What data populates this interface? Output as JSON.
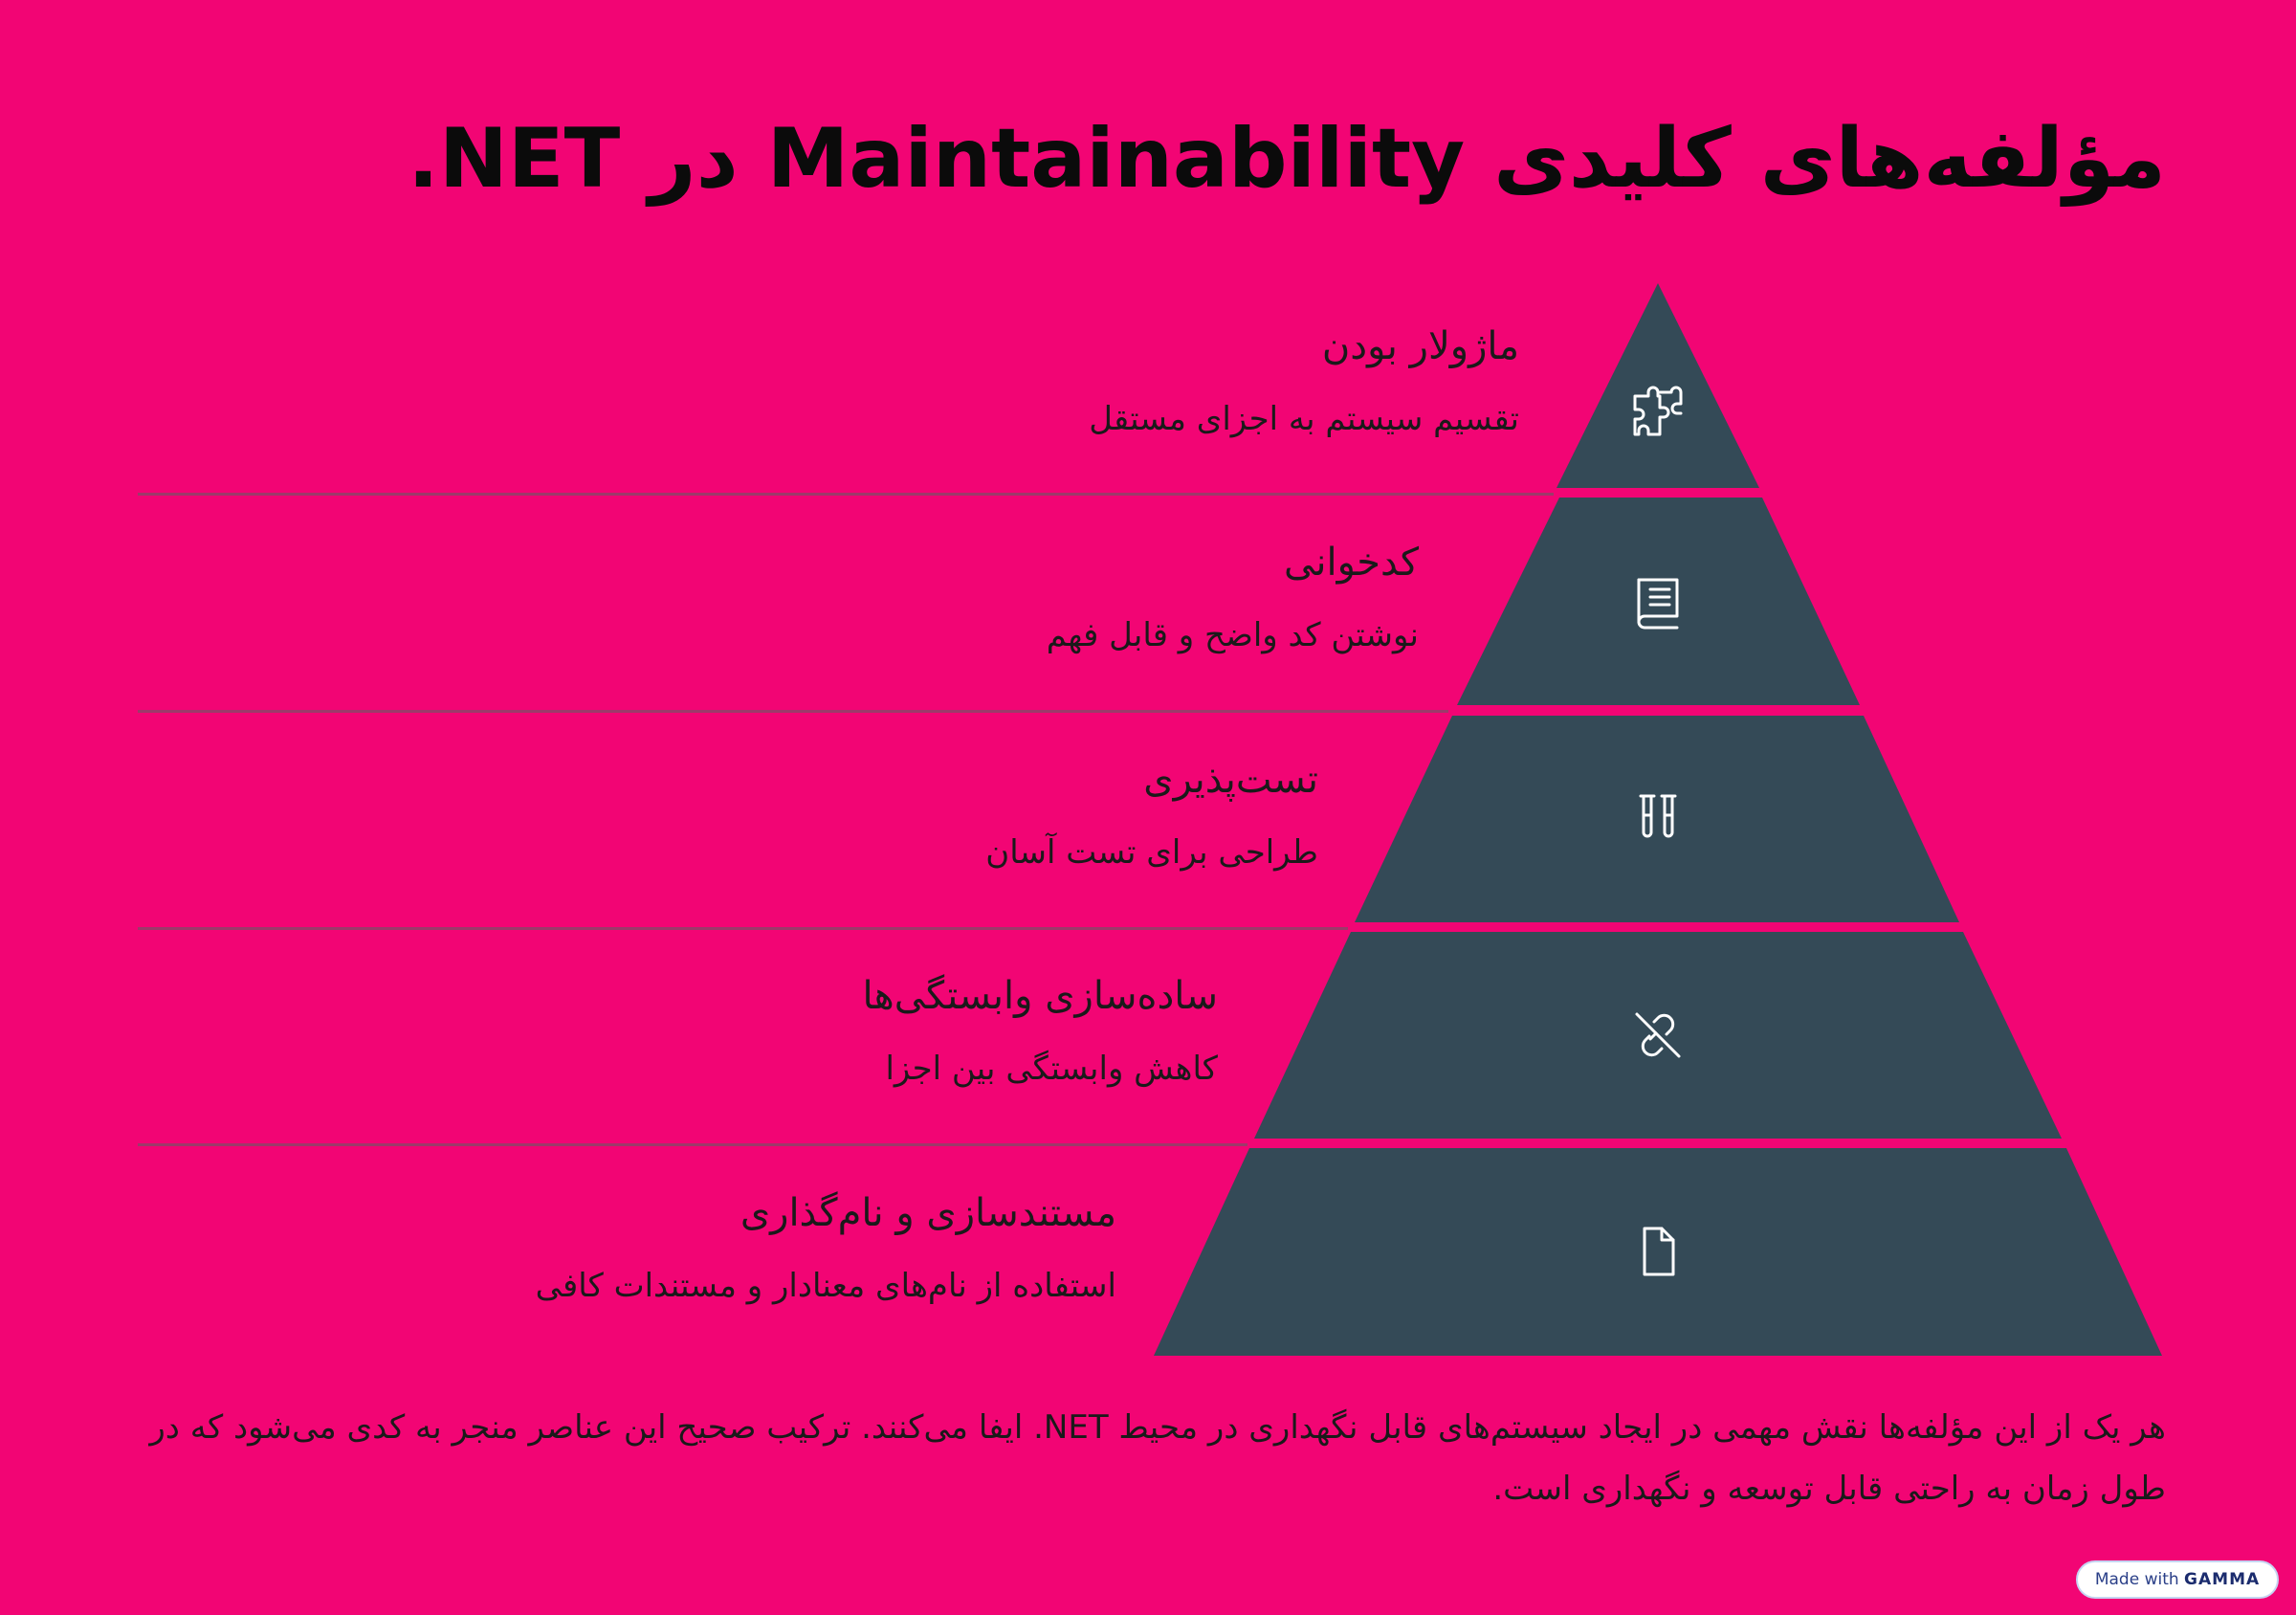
{
  "slide": {
    "title": "مؤلفه‌های کلیدی Maintainability در NET.",
    "layers": [
      {
        "title": "ماژولار بودن",
        "description": "تقسیم سیستم به اجزای مستقل",
        "icon": "puzzle-icon"
      },
      {
        "title": "کدخوانی",
        "description": "نوشتن کد واضح و قابل فهم",
        "icon": "book-icon"
      },
      {
        "title": "تست‌پذیری",
        "description": "طراحی برای تست آسان",
        "icon": "test-tubes-icon"
      },
      {
        "title": "ساده‌سازی وابستگی‌ها",
        "description": "کاهش وابستگی بین اجزا",
        "icon": "unlink-icon"
      },
      {
        "title": "مستندسازی و نام‌گذاری",
        "description": "استفاده از نام‌های معنادار و مستندات کافی",
        "icon": "document-icon"
      }
    ],
    "footer": "هر یک از این مؤلفه‌ها نقش مهمی در ایجاد سیستم‌های قابل نگهداری در محیط NET. ایفا می‌کنند. ترکیب صحیح این عناصر منجر به کدی می‌شود که در طول زمان به راحتی قابل توسعه و نگهداری است.",
    "badge": {
      "prefix": "Made with",
      "brand": "GAMMA"
    }
  },
  "colors": {
    "background": "#f20574",
    "pyramid": "#344a57",
    "divider": "#9c3a6a",
    "text": "#111111",
    "icon": "#ffffff"
  }
}
